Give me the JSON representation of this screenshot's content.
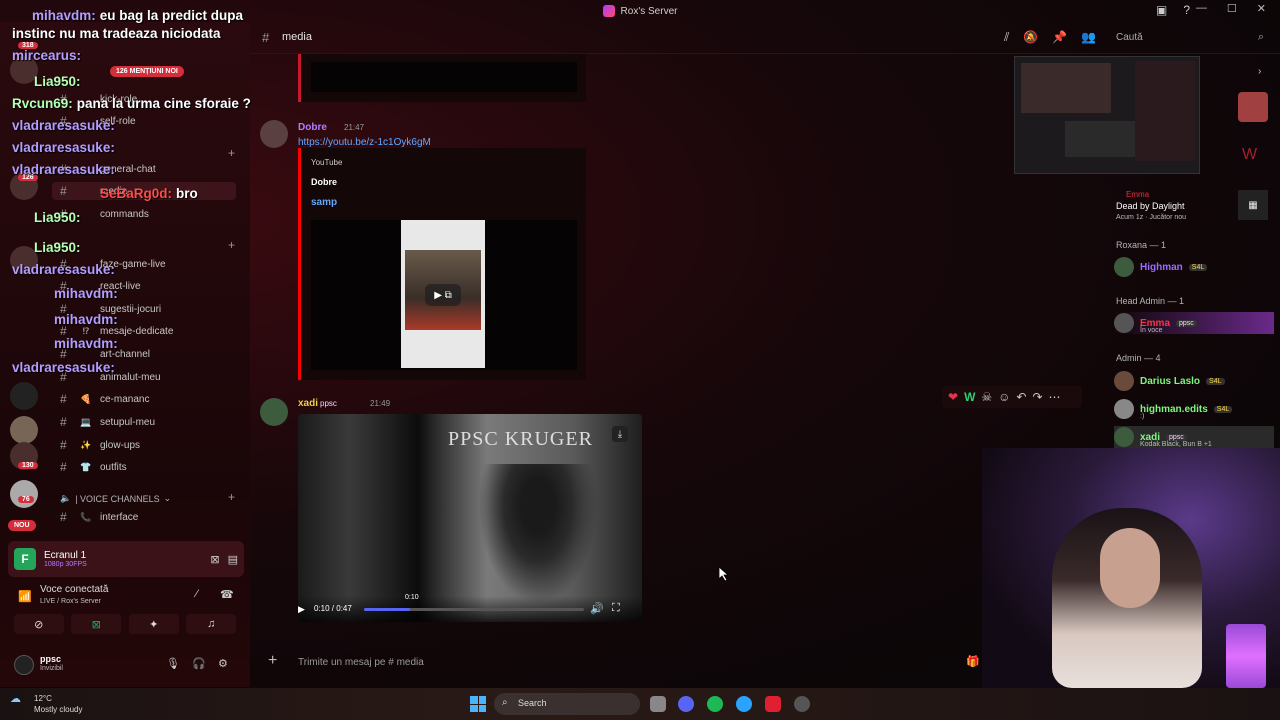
{
  "window": {
    "title": "Rox's Server"
  },
  "chat_overlay": {
    "messages": [
      {
        "user": "mihavdm:",
        "text": "eu bag la predict dupa",
        "color": "purple"
      },
      {
        "user": "",
        "text": "instinc nu ma tradeaza niciodata",
        "color": "purple"
      },
      {
        "user": "mircearus:",
        "text": "",
        "color": "purple"
      },
      {
        "user": "Lia950:",
        "text": "",
        "color": "green"
      },
      {
        "user": "Rvcun69:",
        "text": "pana la urma cine sforaie ?",
        "color": "green"
      },
      {
        "user": "vladraresasuke:",
        "text": "",
        "color": "purple"
      },
      {
        "user": "vladraresasuke:",
        "text": "",
        "color": "purple"
      },
      {
        "user": "vladraresasuke:",
        "text": "",
        "color": "purple"
      },
      {
        "user": "SeBaRg0d:",
        "text": "bro",
        "color": "red"
      },
      {
        "user": "Lia950:",
        "text": "",
        "color": "green"
      },
      {
        "user": "Lia950:",
        "text": "",
        "color": "green"
      },
      {
        "user": "vladraresasuke:",
        "text": "",
        "color": "purple"
      },
      {
        "user": "mihavdm:",
        "text": "",
        "color": "purple"
      },
      {
        "user": "mihavdm:",
        "text": "",
        "color": "purple"
      },
      {
        "user": "mihavdm:",
        "text": "",
        "color": "purple"
      },
      {
        "user": "vladraresasuke:",
        "text": "",
        "color": "purple"
      }
    ],
    "mentions_badge": "126 MENȚIUNI NOI"
  },
  "sidebar": {
    "server_badges": [
      "318",
      "126",
      "130",
      "76",
      "NOU"
    ],
    "channels": [
      {
        "emoji": "",
        "label": "kick-role"
      },
      {
        "emoji": "",
        "label": "self-role"
      },
      {
        "emoji": "",
        "label": "general-chat"
      },
      {
        "emoji": "",
        "label": "media"
      },
      {
        "emoji": "",
        "label": "commands"
      },
      {
        "emoji": "",
        "label": "faze-game-live"
      },
      {
        "emoji": "",
        "label": "react-live"
      },
      {
        "emoji": "",
        "label": "sugestii-jocuri"
      },
      {
        "emoji": "⁉",
        "label": "mesaje-dedicate"
      },
      {
        "emoji": "",
        "label": "art-channel"
      },
      {
        "emoji": "",
        "label": "animalut-meu"
      },
      {
        "emoji": "🍕",
        "label": "ce-mananc"
      },
      {
        "emoji": "💻",
        "label": "setupul-meu"
      },
      {
        "emoji": "✨",
        "label": "glow-ups"
      },
      {
        "emoji": "👕",
        "label": "outfits"
      },
      {
        "emoji": "📞",
        "label": "interface"
      }
    ],
    "voice_category": "| VOICE CHANNELS",
    "stream": {
      "title": "Ecranul 1",
      "quality": "1080p 30FPS"
    },
    "voice": {
      "status": "Voce conectată",
      "server": "LIVE / Rox's Server"
    },
    "user": {
      "name": "ppsc",
      "status": "Invizibil"
    }
  },
  "header": {
    "channel": "media",
    "search_placeholder": "Caută"
  },
  "messages": {
    "m1": {
      "user": "Dobre",
      "time": "21:47",
      "link": "https://youtu.be/z-1c1Oyk6gM",
      "embed_provider": "YouTube",
      "embed_author": "Dobre",
      "embed_title": "samp"
    },
    "m2": {
      "user": "xadi",
      "tag": "ppsc",
      "time": "21:49",
      "video_title": "PPSC KRUGER",
      "video_time": "0:10 / 0:47",
      "video_tooltip": "0:10",
      "progress": 0.21
    }
  },
  "composer": {
    "placeholder": "Trimite un mesaj pe #",
    "channel": "media"
  },
  "members": {
    "activity": {
      "name": "Emma",
      "game": "Dead by Daylight",
      "detail": "Acum 1z · Jucător nou"
    },
    "groups": [
      {
        "header": "Roxana — 1",
        "members": [
          {
            "name": "Highman",
            "tag": "S4L",
            "sub": ""
          }
        ]
      },
      {
        "header": "Head Admin — 1",
        "members": [
          {
            "name": "Emma",
            "tag": "ppsc",
            "sub": "În voce"
          }
        ]
      },
      {
        "header": "Admin — 4",
        "members": [
          {
            "name": "Darius Laslo",
            "tag": "S4L",
            "sub": ""
          },
          {
            "name": "highman.edits",
            "tag": "S4L",
            "sub": ":)"
          },
          {
            "name": "xadi",
            "tag": "ppsc",
            "sub": "Kodak Black, Bun B +1"
          }
        ]
      }
    ]
  },
  "taskbar": {
    "temp": "12°C",
    "weather": "Mostly cloudy",
    "search": "Search"
  },
  "colors": {
    "accent": "#5865f2",
    "brand_red": "#c9182c",
    "link": "#62a8ff"
  }
}
